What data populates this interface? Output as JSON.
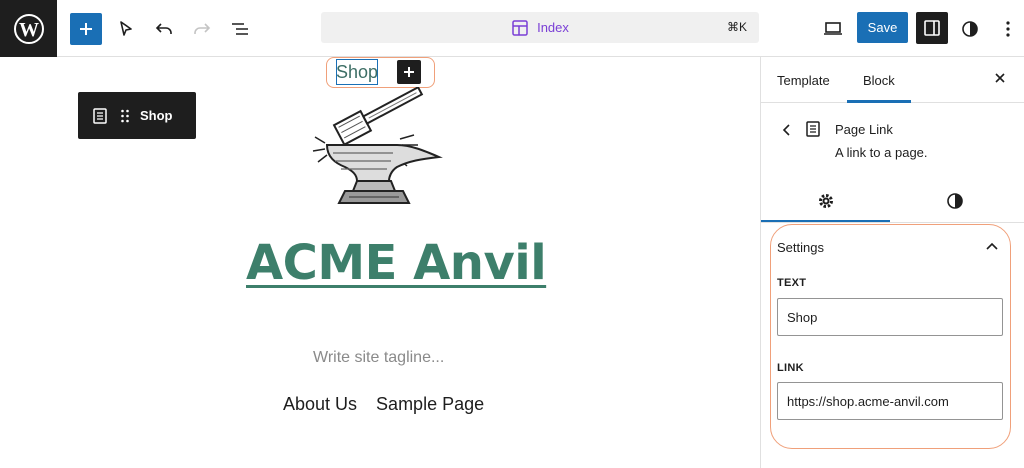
{
  "toolbar": {
    "logo_icon": "wordpress-icon",
    "command_title": "Index",
    "command_shortcut": "⌘K",
    "save_label": "Save"
  },
  "canvas": {
    "block_toolbar_label": "Shop",
    "link_text": "Shop",
    "site_title": "ACME Anvil",
    "tagline": "Write site tagline...",
    "nav_items": [
      "About Us",
      "Sample Page"
    ]
  },
  "sidebar": {
    "tabs": [
      "Template",
      "Block"
    ],
    "active_tab": "Block",
    "block_name": "Page Link",
    "block_description": "A link to a page.",
    "panel_title": "Settings",
    "fields": [
      {
        "label": "TEXT",
        "value": "Shop"
      },
      {
        "label": "LINK",
        "value": "https://shop.acme-anvil.com"
      }
    ]
  },
  "colors": {
    "accent": "#1a6fb5",
    "site_title": "#3d7f6b",
    "command_title": "#7a3fd6",
    "highlight": "#f0a07a"
  }
}
